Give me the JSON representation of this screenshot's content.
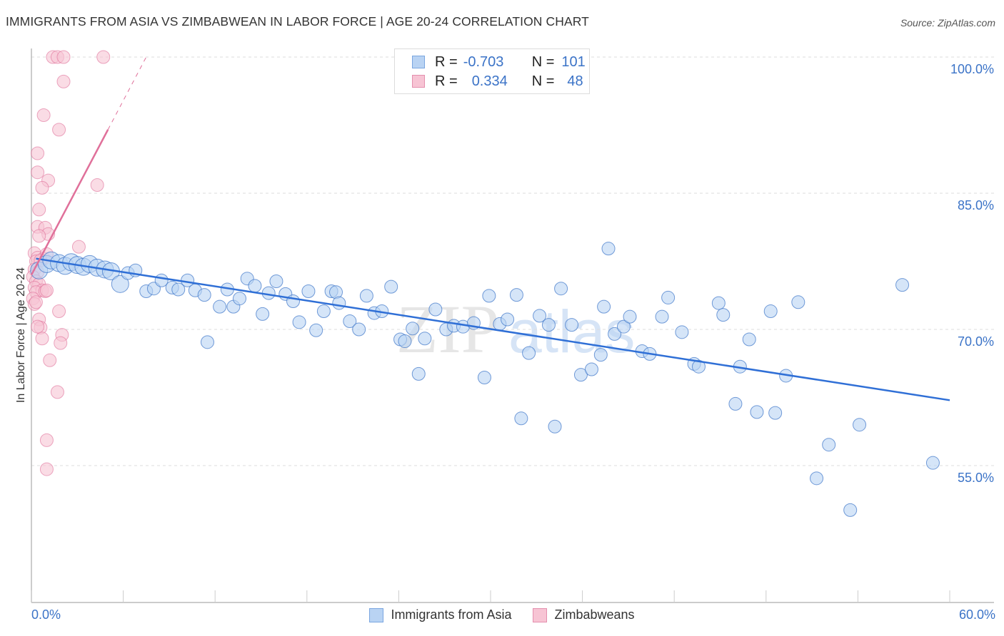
{
  "header": {
    "title": "IMMIGRANTS FROM ASIA VS ZIMBABWEAN IN LABOR FORCE | AGE 20-24 CORRELATION CHART",
    "source": "Source: ZipAtlas.com"
  },
  "watermark": {
    "part1": "ZIP",
    "part2": "atlas"
  },
  "colors": {
    "blue": "#3b73c7",
    "blue_fill": "#b9d3f3",
    "blue_line": "#2f6fd6",
    "pink": "#e0709a",
    "pink_fill": "#f7c4d4",
    "pink_line": "#e0709a"
  },
  "legend": {
    "rows": [
      {
        "r_label": "R =",
        "r_value": "-0.703",
        "n_label": "N =",
        "n_value": "101"
      },
      {
        "r_label": "R =",
        "r_value": "0.334",
        "n_label": "N =",
        "n_value": "48"
      }
    ]
  },
  "chart_data": {
    "type": "scatter",
    "title": "IMMIGRANTS FROM ASIA VS ZIMBABWEAN IN LABOR FORCE | AGE 20-24 CORRELATION CHART",
    "xlabel": "",
    "ylabel": "In Labor Force | Age 20-24",
    "xlim": [
      0,
      60
    ],
    "ylim": [
      41.5,
      102.5
    ],
    "x_tick_labels": [
      "0.0%",
      "60.0%"
    ],
    "y_ticks": [
      55,
      70,
      85,
      100
    ],
    "y_tick_labels": [
      "55.0%",
      "70.0%",
      "85.0%",
      "100.0%"
    ],
    "grid": true,
    "legend_position": "bottom-center",
    "series": [
      {
        "name": "Immigrants from Asia",
        "R": -0.703,
        "N": 101,
        "trend": {
          "x": [
            0.3,
            60
          ],
          "y": [
            77.8,
            62.2
          ]
        },
        "points": [
          [
            0.5,
            76.5
          ],
          [
            1.0,
            77.2
          ],
          [
            1.3,
            77.6
          ],
          [
            1.8,
            77.3
          ],
          [
            2.2,
            77.0
          ],
          [
            2.6,
            77.4
          ],
          [
            3.0,
            77.1
          ],
          [
            3.4,
            76.9
          ],
          [
            3.8,
            77.2
          ],
          [
            4.3,
            76.8
          ],
          [
            4.8,
            76.6
          ],
          [
            5.2,
            76.4
          ],
          [
            5.8,
            75.0
          ],
          [
            6.3,
            76.2
          ],
          [
            6.8,
            76.5
          ],
          [
            7.5,
            74.2
          ],
          [
            8.0,
            74.5
          ],
          [
            8.5,
            75.4
          ],
          [
            9.2,
            74.6
          ],
          [
            9.6,
            74.4
          ],
          [
            10.2,
            75.4
          ],
          [
            10.7,
            74.3
          ],
          [
            11.5,
            68.6
          ],
          [
            11.3,
            73.8
          ],
          [
            12.3,
            72.5
          ],
          [
            12.8,
            74.4
          ],
          [
            13.2,
            72.5
          ],
          [
            13.6,
            73.4
          ],
          [
            14.1,
            75.6
          ],
          [
            14.6,
            74.8
          ],
          [
            15.1,
            71.7
          ],
          [
            15.5,
            74.0
          ],
          [
            16.0,
            75.3
          ],
          [
            16.6,
            73.9
          ],
          [
            17.1,
            73.1
          ],
          [
            17.5,
            70.8
          ],
          [
            18.1,
            74.2
          ],
          [
            18.6,
            69.9
          ],
          [
            19.1,
            72.0
          ],
          [
            19.6,
            74.2
          ],
          [
            19.9,
            74.1
          ],
          [
            20.1,
            72.9
          ],
          [
            20.8,
            70.9
          ],
          [
            21.4,
            70.0
          ],
          [
            21.9,
            73.7
          ],
          [
            22.4,
            71.8
          ],
          [
            22.9,
            72.0
          ],
          [
            23.5,
            74.7
          ],
          [
            24.1,
            68.9
          ],
          [
            24.4,
            68.7
          ],
          [
            24.9,
            70.1
          ],
          [
            25.3,
            65.1
          ],
          [
            25.7,
            69.0
          ],
          [
            26.4,
            72.2
          ],
          [
            27.1,
            70.0
          ],
          [
            27.6,
            70.4
          ],
          [
            28.2,
            70.3
          ],
          [
            28.9,
            70.7
          ],
          [
            29.6,
            64.7
          ],
          [
            29.9,
            73.7
          ],
          [
            30.6,
            70.6
          ],
          [
            31.1,
            71.1
          ],
          [
            31.7,
            73.8
          ],
          [
            32.0,
            60.2
          ],
          [
            32.5,
            67.4
          ],
          [
            33.2,
            71.5
          ],
          [
            33.8,
            70.5
          ],
          [
            34.2,
            59.3
          ],
          [
            34.6,
            74.5
          ],
          [
            35.3,
            70.5
          ],
          [
            35.9,
            65.0
          ],
          [
            36.6,
            65.6
          ],
          [
            37.2,
            67.2
          ],
          [
            37.4,
            72.5
          ],
          [
            37.7,
            78.9
          ],
          [
            38.1,
            69.5
          ],
          [
            38.7,
            70.3
          ],
          [
            39.1,
            71.4
          ],
          [
            39.9,
            67.6
          ],
          [
            40.4,
            67.3
          ],
          [
            41.2,
            71.4
          ],
          [
            41.6,
            73.5
          ],
          [
            42.5,
            69.7
          ],
          [
            43.3,
            66.2
          ],
          [
            43.6,
            65.9
          ],
          [
            44.9,
            72.9
          ],
          [
            45.2,
            71.6
          ],
          [
            46.0,
            61.8
          ],
          [
            46.3,
            65.9
          ],
          [
            46.9,
            68.9
          ],
          [
            47.4,
            60.9
          ],
          [
            48.3,
            72.0
          ],
          [
            48.6,
            60.8
          ],
          [
            49.3,
            64.9
          ],
          [
            50.1,
            73.0
          ],
          [
            51.3,
            53.6
          ],
          [
            52.1,
            57.3
          ],
          [
            53.5,
            50.1
          ],
          [
            54.1,
            59.5
          ],
          [
            56.9,
            74.9
          ],
          [
            58.9,
            55.3
          ]
        ]
      },
      {
        "name": "Zimbabweans",
        "R": 0.334,
        "N": 48,
        "trend": {
          "x": [
            0.0,
            5.0
          ],
          "y": [
            76.0,
            92.0
          ],
          "dashed_to": {
            "x": 7.5,
            "y": 100.0
          }
        },
        "points": [
          [
            1.4,
            100.0
          ],
          [
            1.7,
            100.0
          ],
          [
            2.1,
            100.0
          ],
          [
            4.7,
            100.0
          ],
          [
            2.1,
            97.3
          ],
          [
            0.8,
            93.6
          ],
          [
            1.8,
            92.0
          ],
          [
            0.4,
            89.4
          ],
          [
            0.4,
            87.3
          ],
          [
            1.1,
            86.4
          ],
          [
            0.7,
            85.6
          ],
          [
            4.3,
            85.9
          ],
          [
            0.5,
            83.2
          ],
          [
            0.4,
            81.3
          ],
          [
            0.9,
            81.2
          ],
          [
            1.1,
            80.5
          ],
          [
            0.5,
            80.3
          ],
          [
            3.1,
            79.1
          ],
          [
            0.2,
            78.4
          ],
          [
            0.4,
            77.9
          ],
          [
            0.8,
            77.8
          ],
          [
            1.0,
            78.3
          ],
          [
            0.3,
            77.5
          ],
          [
            0.6,
            77.6
          ],
          [
            0.2,
            76.6
          ],
          [
            0.4,
            76.3
          ],
          [
            0.1,
            75.8
          ],
          [
            0.3,
            75.3
          ],
          [
            0.5,
            75.0
          ],
          [
            0.2,
            74.6
          ],
          [
            0.7,
            74.3
          ],
          [
            0.3,
            74.1
          ],
          [
            0.9,
            74.2
          ],
          [
            1.0,
            74.3
          ],
          [
            0.1,
            73.4
          ],
          [
            0.2,
            72.8
          ],
          [
            1.8,
            72.0
          ],
          [
            0.5,
            71.1
          ],
          [
            0.6,
            70.2
          ],
          [
            0.7,
            69.0
          ],
          [
            2.0,
            69.4
          ],
          [
            1.9,
            68.5
          ],
          [
            1.2,
            66.6
          ],
          [
            1.7,
            63.1
          ],
          [
            1.0,
            57.8
          ],
          [
            1.0,
            54.6
          ],
          [
            0.3,
            73.0
          ],
          [
            0.4,
            70.3
          ]
        ]
      }
    ]
  },
  "bottom_legend": {
    "items": [
      {
        "label": "Immigrants from Asia"
      },
      {
        "label": "Zimbabweans"
      }
    ]
  }
}
